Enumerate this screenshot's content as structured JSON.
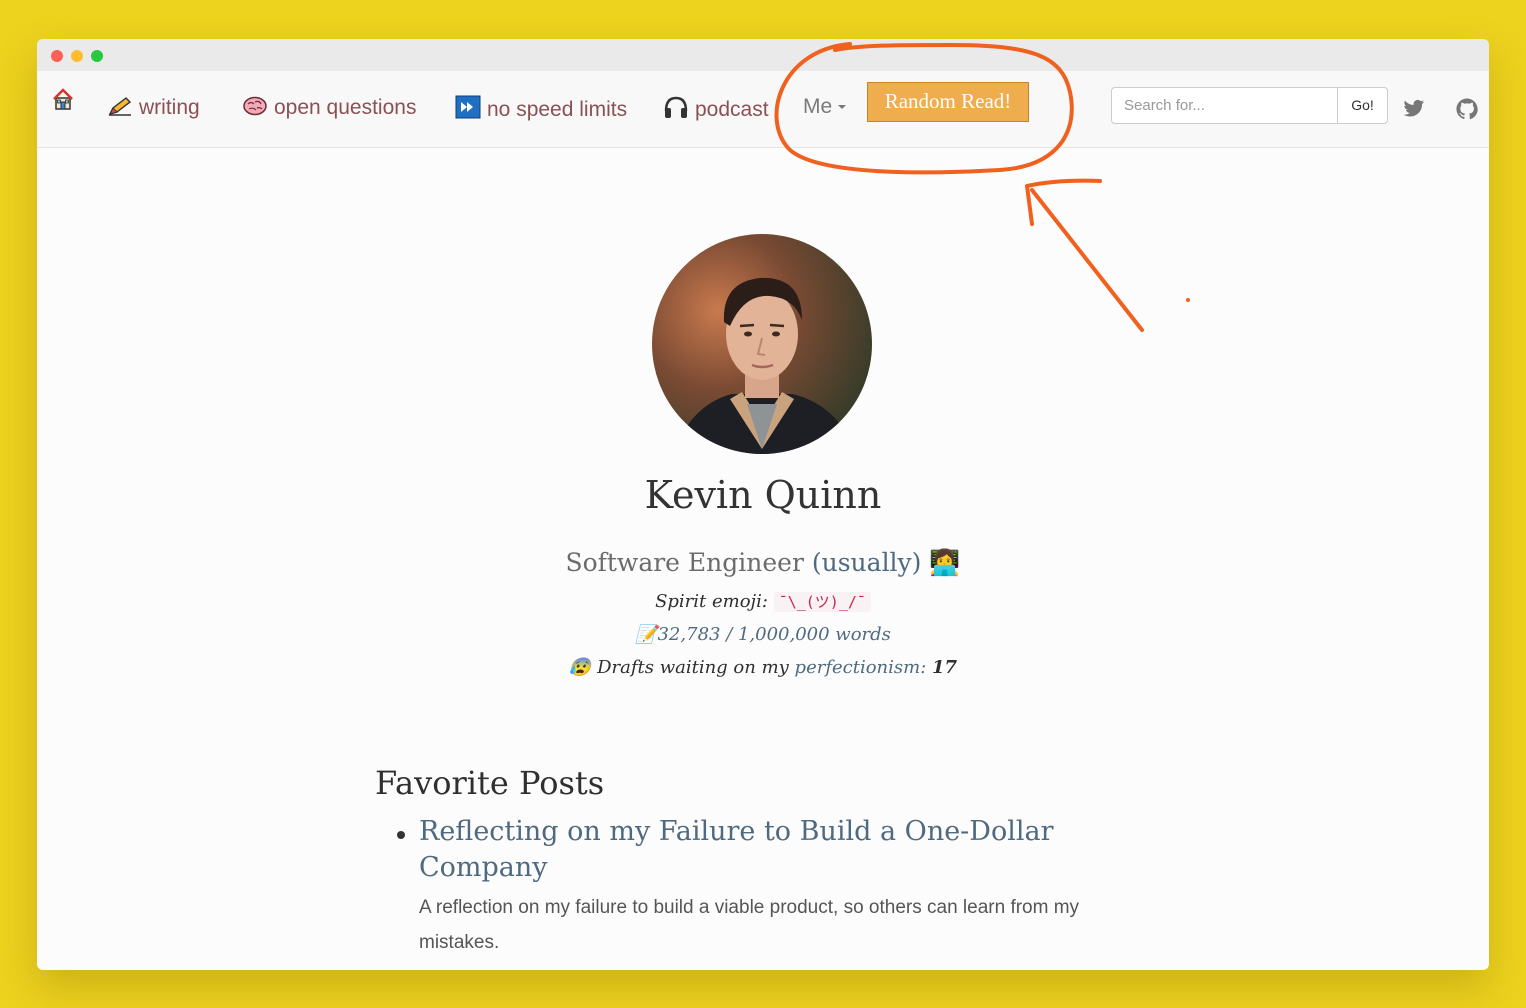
{
  "nav": {
    "home_icon": "house-icon",
    "items": [
      {
        "label": "writing",
        "icon": "pencil-icon"
      },
      {
        "label": "open questions",
        "icon": "brain-icon"
      },
      {
        "label": "no speed limits",
        "icon": "fast-forward-icon"
      },
      {
        "label": "podcast",
        "icon": "headphones-icon"
      }
    ],
    "me_label": "Me",
    "random_label": "Random Read!",
    "search_placeholder": "Search for...",
    "go_label": "Go!",
    "social_icons": [
      "twitter-icon",
      "github-icon"
    ]
  },
  "profile": {
    "name": "Kevin Quinn",
    "role": "Software Engineer",
    "role_qualifier": "(usually)",
    "role_emoji": "👩‍💻",
    "spirit_label": "Spirit emoji:",
    "spirit_value": "¯\\_(ツ)_/¯",
    "words_emoji": "📝",
    "words_text": "32,783 / 1,000,000 words",
    "drafts_emoji": "😰",
    "drafts_prefix": "Drafts waiting on my",
    "drafts_link": "perfectionism:",
    "drafts_count": "17"
  },
  "favorites": {
    "title": "Favorite Posts",
    "posts": [
      {
        "title": "Reflecting on my Failure to Build a One-Dollar Company",
        "description": "A reflection on my failure to build a viable product, so others can learn from my mistakes."
      }
    ]
  },
  "colors": {
    "background": "#EDD21E",
    "annotation": "#F0601E",
    "random_button": "#F0AD4E",
    "nav_link": "#8A5155",
    "link": "#4F6A80"
  }
}
